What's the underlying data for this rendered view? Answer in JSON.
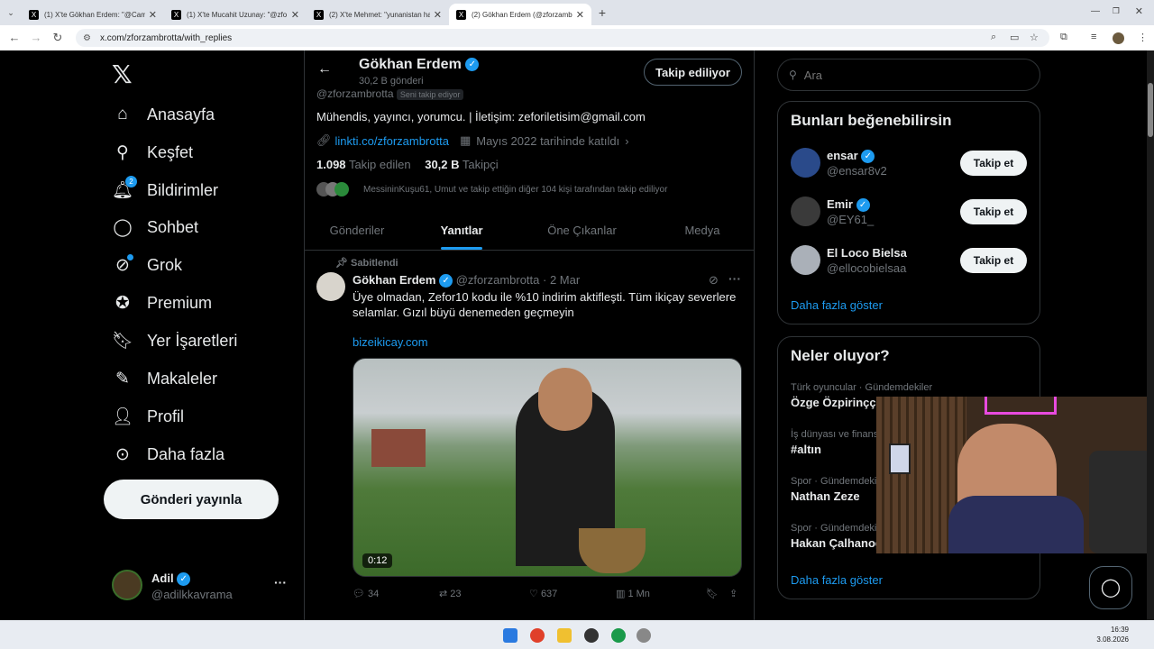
{
  "browser": {
    "tabs": [
      {
        "title": "(1) X'te Gökhan Erdem: \"@Cam",
        "favicon": "X"
      },
      {
        "title": "(1) X'te Mucahit Uzunay: \"@zfo",
        "favicon": "X"
      },
      {
        "title": "(2) X'te Mehmet: \"yunanistan ha",
        "favicon": "X"
      },
      {
        "title": "(2) Gökhan Erdem (@zforzamb",
        "favicon": "X"
      }
    ],
    "url": "x.com/zforzambrotta/with_replies"
  },
  "sidebar": {
    "items": [
      {
        "label": "Anasayfa",
        "icon": "home-icon"
      },
      {
        "label": "Keşfet",
        "icon": "search-icon"
      },
      {
        "label": "Bildirimler",
        "icon": "bell-icon",
        "badge": "2"
      },
      {
        "label": "Sohbet",
        "icon": "chat-icon"
      },
      {
        "label": "Grok",
        "icon": "grok-icon"
      },
      {
        "label": "Premium",
        "icon": "premium-icon"
      },
      {
        "label": "Yer İşaretleri",
        "icon": "bookmark-icon"
      },
      {
        "label": "Makaleler",
        "icon": "articles-icon"
      },
      {
        "label": "Profil",
        "icon": "profile-icon"
      },
      {
        "label": "Daha fazla",
        "icon": "more-icon"
      }
    ],
    "post_button": "Gönderi yayınla",
    "account": {
      "name": "Adil",
      "handle": "@adilkkavrama"
    }
  },
  "profile": {
    "name": "Gökhan Erdem",
    "posts_count": "30,2 B gönderi",
    "follow_button": "Takip ediliyor",
    "handle": "@zforzambrotta",
    "follows_you": "Seni takip ediyor",
    "bio": "Mühendis, yayıncı, yorumcu. | İletişim: zeforiletisim@gmail.com",
    "link": "linkti.co/zforzambrotta",
    "joined": "Mayıs 2022 tarihinde katıldı",
    "following_count": "1.098",
    "following_label": "Takip edilen",
    "followers_count": "30,2 B",
    "followers_label": "Takipçi",
    "followed_by": "MessininKuşu61, Umut ve takip ettiğin diğer 104 kişi tarafından takip ediliyor",
    "tabs": [
      "Gönderiler",
      "Yanıtlar",
      "Öne Çıkanlar",
      "Medya"
    ],
    "active_tab": "Yanıtlar"
  },
  "pinned_post": {
    "pinned_label": "Sabitlendi",
    "author": "Gökhan Erdem",
    "handle": "@zforzambrotta",
    "date": "· 2 Mar",
    "text": "Üye olmadan, Zefor10 kodu ile %10 indirim aktifleşti. Tüm ikiçay severlere selamlar. Gızıl büyü denemeden geçmeyin",
    "link": "bizeikicay.com",
    "video_duration": "0:12",
    "replies": "34",
    "reposts": "23",
    "likes": "637",
    "views": "1 Mn"
  },
  "search": {
    "placeholder": "Ara"
  },
  "suggestions": {
    "title": "Bunları beğenebilirsin",
    "users": [
      {
        "name": "ensar",
        "handle": "@ensar8v2",
        "button": "Takip et"
      },
      {
        "name": "Emir",
        "handle": "@EY61_",
        "button": "Takip et"
      },
      {
        "name": "El Loco Bielsa",
        "handle": "@ellocobielsaa",
        "button": "Takip et"
      }
    ],
    "show_more": "Daha fazla göster"
  },
  "trends": {
    "title": "Neler oluyor?",
    "items": [
      {
        "context": "Türk oyuncular · Gündemdekiler",
        "name": "Özge Özpirinççi"
      },
      {
        "context": "İş dünyası ve finans",
        "name": "#altın"
      },
      {
        "context": "Spor · Gündemdeki",
        "name": "Nathan Zeze"
      },
      {
        "context": "Spor · Gündemdeki",
        "name": "Hakan Çalhanoğ"
      }
    ],
    "show_more": "Daha fazla göster"
  },
  "clock": {
    "time": "16:39",
    "date": "3.08.2026"
  }
}
